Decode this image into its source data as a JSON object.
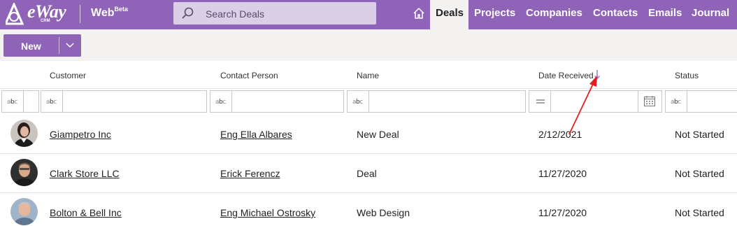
{
  "app": {
    "logo_text": "eWay",
    "logo_sub": "CRM",
    "product": "Web",
    "product_badge": "Beta"
  },
  "search": {
    "placeholder": "Search Deals"
  },
  "nav": {
    "items": [
      {
        "label": "Deals",
        "active": true
      },
      {
        "label": "Projects",
        "active": false
      },
      {
        "label": "Companies",
        "active": false
      },
      {
        "label": "Contacts",
        "active": false
      },
      {
        "label": "Emails",
        "active": false
      },
      {
        "label": "Journal",
        "active": false
      }
    ]
  },
  "toolbar": {
    "new_label": "New"
  },
  "table": {
    "columns": [
      "Customer",
      "Contact Person",
      "Name",
      "Date Received",
      "Status"
    ],
    "sort": {
      "column": "Date Received",
      "direction": "descending"
    },
    "rows": [
      {
        "customer": "Giampetro Inc",
        "contact": "Eng Ella Albares",
        "name": "New Deal",
        "date": "2/12/2021",
        "status": "Not Started"
      },
      {
        "customer": "Clark Store LLC",
        "contact": "Erick Ferencz",
        "name": "Deal",
        "date": "11/27/2020",
        "status": "Not Started"
      },
      {
        "customer": "Bolton & Bell Inc",
        "contact": "Eng Michael Ostrosky",
        "name": "Web Design",
        "date": "11/27/2020",
        "status": "Not Started"
      }
    ]
  },
  "colors": {
    "brand": "#8e63b8",
    "search_bg": "#dbcfe8",
    "toolbar_bg": "#f3f2f1",
    "annotation_arrow": "#e02020"
  }
}
